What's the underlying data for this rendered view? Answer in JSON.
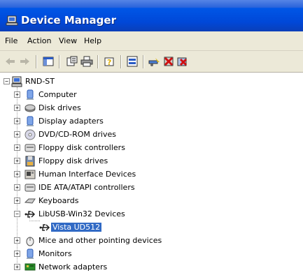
{
  "window": {
    "title": "Device Manager",
    "title_bar_color": "#0054e3",
    "menu_bar_color": "#ece9d8",
    "selection_color": "#316ac5"
  },
  "menu": [
    "File",
    "Action",
    "View",
    "Help"
  ],
  "toolbar": [
    "back-arrow-icon",
    "forward-arrow-icon",
    "console-tree-icon",
    "properties-icon",
    "print-icon",
    "help-icon",
    "device-view-icon",
    "scan-hardware-icon",
    "uninstall-icon",
    "disable-icon"
  ],
  "tree": {
    "root": "RND-ST",
    "items": [
      {
        "label": "Computer",
        "icon": "computer-icon",
        "expanded": false
      },
      {
        "label": "Disk drives",
        "icon": "disk-drive-icon",
        "expanded": false
      },
      {
        "label": "Display adapters",
        "icon": "display-adapter-icon",
        "expanded": false
      },
      {
        "label": "DVD/CD-ROM drives",
        "icon": "cdrom-icon",
        "expanded": false
      },
      {
        "label": "Floppy disk controllers",
        "icon": "floppy-controller-icon",
        "expanded": false
      },
      {
        "label": "Floppy disk drives",
        "icon": "floppy-drive-icon",
        "expanded": false
      },
      {
        "label": "Human Interface Devices",
        "icon": "hid-icon",
        "expanded": false
      },
      {
        "label": "IDE ATA/ATAPI controllers",
        "icon": "ide-controller-icon",
        "expanded": false
      },
      {
        "label": "Keyboards",
        "icon": "keyboard-icon",
        "expanded": false
      },
      {
        "label": "LibUSB-Win32 Devices",
        "icon": "usb-icon",
        "expanded": true
      },
      {
        "label": "Vista UD512",
        "icon": "usb-icon",
        "child": true,
        "selected": true
      },
      {
        "label": "Mice and other pointing devices",
        "icon": "mouse-icon",
        "expanded": false
      },
      {
        "label": "Monitors",
        "icon": "monitor-icon",
        "expanded": false
      },
      {
        "label": "Network adapters",
        "icon": "network-adapter-icon",
        "expanded": false
      }
    ]
  }
}
